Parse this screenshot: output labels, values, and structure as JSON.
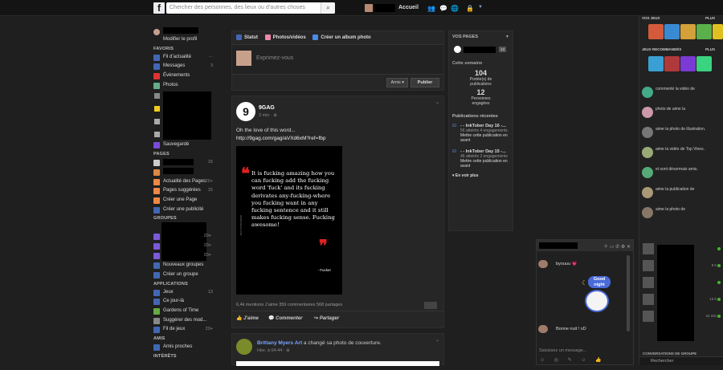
{
  "topbar": {
    "search_placeholder": "Chercher des personnes, des lieux ou d’autres choses",
    "home": "Accueil"
  },
  "left": {
    "edit_profile": "Modifier le profil",
    "sections": {
      "fav": "FAVORIS",
      "pages": "PAGES",
      "groups": "GROUPES",
      "apps": "APPLICATIONS",
      "friends": "AMIS",
      "interests": "INTÉRÊTS"
    },
    "fav": [
      {
        "label": "Fil d’actualité",
        "count": "···"
      },
      {
        "label": "Messages",
        "count": "3"
      },
      {
        "label": "Évènements",
        "count": ""
      },
      {
        "label": "Photos",
        "count": ""
      }
    ],
    "saved": "Sauvegardé",
    "pages_count": "15",
    "pages_items": [
      {
        "label": "Actualité des Pages",
        "count": "20+"
      },
      {
        "label": "Pages suggérées",
        "count": "15"
      },
      {
        "label": "Créer une Page",
        "count": ""
      },
      {
        "label": "Créer une publicité",
        "count": ""
      }
    ],
    "group_counts": [
      "20+",
      "20+",
      "20+"
    ],
    "groups_items": [
      {
        "label": "Nouveaux groupes"
      },
      {
        "label": "Créer un groupe"
      }
    ],
    "apps": [
      {
        "label": "Jeux",
        "count": "13"
      },
      {
        "label": "Ce jour-là",
        "count": ""
      },
      {
        "label": "Gardens of Time",
        "count": ""
      },
      {
        "label": "Suggérer des mod...",
        "count": ""
      },
      {
        "label": "Fil de jeux",
        "count": "20+"
      }
    ],
    "friends": [
      {
        "label": "Amis proches"
      }
    ]
  },
  "composer": {
    "tab_status": "Statut",
    "tab_photos": "Photos/vidéos",
    "tab_album": "Créer un album photo",
    "placeholder": "Exprimez-vous",
    "audience": "Amis ▾",
    "publish": "Publier"
  },
  "post": {
    "author": "9GAG",
    "time": "3 min · ⊕",
    "text": "Oh the love of this word...",
    "link": "http://9gag.com/gag/aVXd6xM?ref=fbp",
    "quote": "It is fucking amazing how you can fucking add the fucking word 'fuck' and its fucking derivates any-fucking-where you fucking want in any fucking sentence and it still makes fucking sense. Fucking awesome!",
    "quote_by": "- Fucker",
    "side": "WWW.9GAG.COM",
    "stats": "6,4k mentions J’aime  359 commentaires  568 partages",
    "like": "J’aime",
    "comment": "Commenter",
    "share": "Partager"
  },
  "post2": {
    "author": "Brittany Myers Art",
    "action": " a changé sa photo de couverture.",
    "time": "Hier, à 04:44 · ⊕"
  },
  "right": {
    "title": "VOS PAGES",
    "badge": "13",
    "week": "Cette semaine",
    "n1": "104",
    "l1": "Portée(s) de publications",
    "n2": "12",
    "l2": "Personnes engagées",
    "recent": "Publications récentes",
    "pubs": [
      {
        "t": "- - InkTober Day 16 -...",
        "s": "56 atteints 4 engagements",
        "c": "Mettre cette publication en avant"
      },
      {
        "t": "- - InkTober Day 15 -...",
        "s": "46 atteints 2 engagements",
        "c": "Mettre cette publication en avant"
      }
    ],
    "more": "▾  En voir plus"
  },
  "side": {
    "games_header": "VOS JEUX",
    "plus": "PLUS",
    "reco_header": "JEUX RECOMMANDÉS",
    "plus2": "PLUS",
    "ticker": [
      "commenté la vidéo de",
      "photo de       aime la",
      "aime la photo de illustration.",
      "aime la vidéo de Top Vines.",
      "et sont désormais amis.",
      "aime la publication de",
      "aime la photo de"
    ],
    "times": [
      "9 h",
      "13 h",
      "41 min"
    ],
    "conv": "CONVERSATIONS DE GROUPE",
    "search": "Rechercher"
  },
  "chat": {
    "m1": "byouuu 💗",
    "m2": "Bonne nuit ! xD",
    "sticker": "Good night",
    "input": "Saisissez un message...",
    "tools": "☺ ◎ ✎ ☺ 👍"
  }
}
